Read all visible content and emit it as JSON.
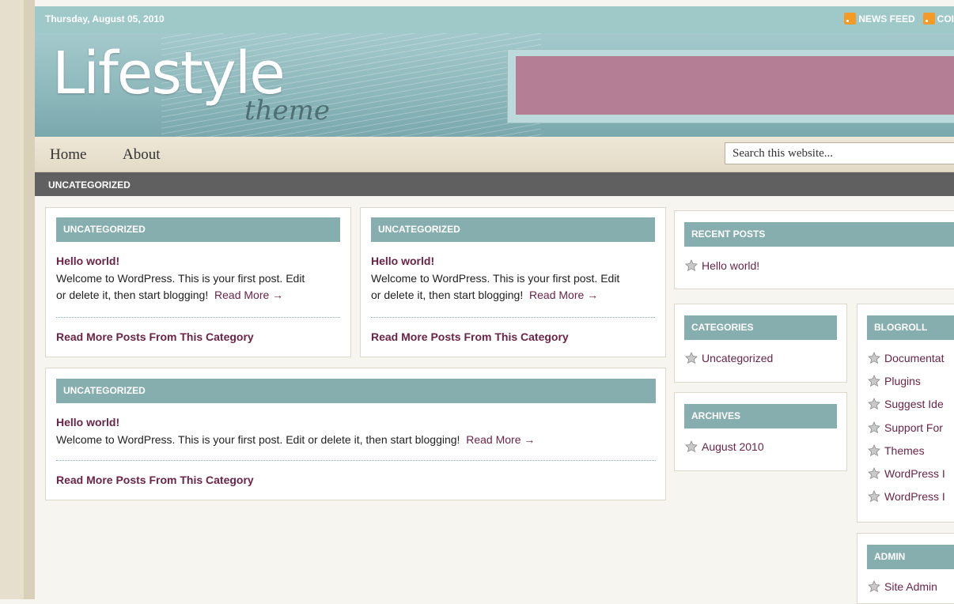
{
  "topbar": {
    "date": "Thursday, August 05, 2010",
    "news_feed": "NEWS FEED",
    "comments_feed": "COI"
  },
  "header": {
    "logo_main": "Lifestyle",
    "logo_sub": "theme"
  },
  "nav": {
    "items": [
      "Home",
      "About"
    ],
    "search_value": "Search this website..."
  },
  "category_bar": {
    "label": "UNCATEGORIZED"
  },
  "posts": [
    {
      "category": "UNCATEGORIZED",
      "title": "Hello world!",
      "excerpt_line1": "Welcome to WordPress. This is your first post. Edit",
      "excerpt_line2": "or delete it, then start blogging!",
      "read_more": "Read More →",
      "more_posts": "Read More Posts From This Category"
    },
    {
      "category": "UNCATEGORIZED",
      "title": "Hello world!",
      "excerpt_line1": "Welcome to WordPress. This is your first post. Edit",
      "excerpt_line2": "or delete it, then start blogging!",
      "read_more": "Read More →",
      "more_posts": "Read More Posts From This Category"
    },
    {
      "category": "UNCATEGORIZED",
      "title": "Hello world!",
      "excerpt_line1": "Welcome to WordPress. This is your first post. Edit or delete it, then start blogging!",
      "read_more": "Read More →",
      "more_posts": "Read More Posts From This Category"
    }
  ],
  "sidebar": {
    "recent_posts": {
      "title": "RECENT POSTS",
      "items": [
        "Hello world!"
      ]
    },
    "categories": {
      "title": "CATEGORIES",
      "items": [
        "Uncategorized"
      ]
    },
    "archives": {
      "title": "ARCHIVES",
      "items": [
        "August 2010"
      ]
    },
    "blogroll": {
      "title": "BLOGROLL",
      "items": [
        "Documentat",
        "Plugins",
        "Suggest Ide",
        "Support For",
        "Themes",
        "WordPress I",
        "WordPress I"
      ]
    },
    "admin": {
      "title": "ADMIN",
      "items": [
        "Site Admin"
      ]
    }
  },
  "colors": {
    "accent_teal": "#86aeaf",
    "link_maroon": "#6b2446",
    "banner_placeholder": "#b47f94",
    "rss_orange": "#f39a27"
  }
}
